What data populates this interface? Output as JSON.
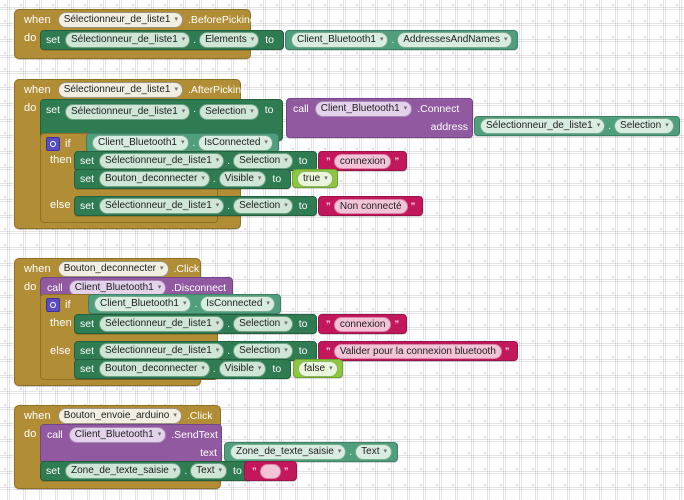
{
  "workspace": {
    "tool": "MIT App Inventor Blocks Editor",
    "background": "#ffffff",
    "grid": "dotted"
  },
  "palette": {
    "event_block": "#b18e35",
    "setter_block": "#2f7b52",
    "getter_block": "#4f9e7c",
    "call_block": "#9059a0",
    "text_block": "#c2185b",
    "logic_block": "#8dc63f",
    "mutator_icon": "#5b4dbf"
  },
  "keywords": {
    "when": "when",
    "do": "do",
    "set": "set",
    "to": "to",
    "call": "call",
    "if": "if",
    "then": "then",
    "else": "else",
    "dot": "."
  },
  "blocks": [
    {
      "id": "b1",
      "event": {
        "component": "Sélectionneur_de_liste1",
        "method": ".BeforePicking"
      },
      "statements": [
        {
          "kind": "set",
          "component": "Sélectionneur_de_liste1",
          "property": "Elements",
          "value": {
            "kind": "getter",
            "component": "Client_Bluetooth1",
            "property": "AddressesAndNames"
          }
        }
      ]
    },
    {
      "id": "b2",
      "event": {
        "component": "Sélectionneur_de_liste1",
        "method": ".AfterPicking"
      },
      "statements": [
        {
          "kind": "set",
          "component": "Sélectionneur_de_liste1",
          "property": "Selection",
          "value": {
            "kind": "call",
            "component": "Client_Bluetooth1",
            "method": ".Connect",
            "arg_label": "address",
            "arg": {
              "kind": "getter",
              "component": "Sélectionneur_de_liste1",
              "property": "Selection"
            }
          }
        },
        {
          "kind": "if",
          "condition": {
            "kind": "getter",
            "component": "Client_Bluetooth1",
            "property": "IsConnected"
          },
          "then": [
            {
              "kind": "set",
              "component": "Sélectionneur_de_liste1",
              "property": "Selection",
              "value": {
                "kind": "text",
                "text": "connexion"
              }
            },
            {
              "kind": "set",
              "component": "Bouton_deconnecter",
              "property": "Visible",
              "value": {
                "kind": "logic",
                "text": "true"
              }
            }
          ],
          "else": [
            {
              "kind": "set",
              "component": "Sélectionneur_de_liste1",
              "property": "Selection",
              "value": {
                "kind": "text",
                "text": "Non connecté"
              }
            }
          ]
        }
      ]
    },
    {
      "id": "b3",
      "event": {
        "component": "Bouton_deconnecter",
        "method": ".Click"
      },
      "statements": [
        {
          "kind": "call",
          "component": "Client_Bluetooth1",
          "method": ".Disconnect"
        },
        {
          "kind": "if",
          "condition": {
            "kind": "getter",
            "component": "Client_Bluetooth1",
            "property": "IsConnected"
          },
          "then": [
            {
              "kind": "set",
              "component": "Sélectionneur_de_liste1",
              "property": "Selection",
              "value": {
                "kind": "text",
                "text": "connexion"
              }
            }
          ],
          "else": [
            {
              "kind": "set",
              "component": "Sélectionneur_de_liste1",
              "property": "Selection",
              "value": {
                "kind": "text",
                "text": "Valider pour la connexion bluetooth"
              }
            },
            {
              "kind": "set",
              "component": "Bouton_deconnecter",
              "property": "Visible",
              "value": {
                "kind": "logic",
                "text": "false"
              }
            }
          ]
        }
      ]
    },
    {
      "id": "b4",
      "event": {
        "component": "Bouton_envoie_arduino",
        "method": ".Click"
      },
      "statements": [
        {
          "kind": "call",
          "component": "Client_Bluetooth1",
          "method": ".SendText",
          "arg_label": "text",
          "arg": {
            "kind": "getter",
            "component": "Zone_de_texte_saisie",
            "property": "Text"
          }
        },
        {
          "kind": "set",
          "component": "Zone_de_texte_saisie",
          "property": "Text",
          "value": {
            "kind": "text",
            "text": ""
          }
        }
      ]
    }
  ]
}
